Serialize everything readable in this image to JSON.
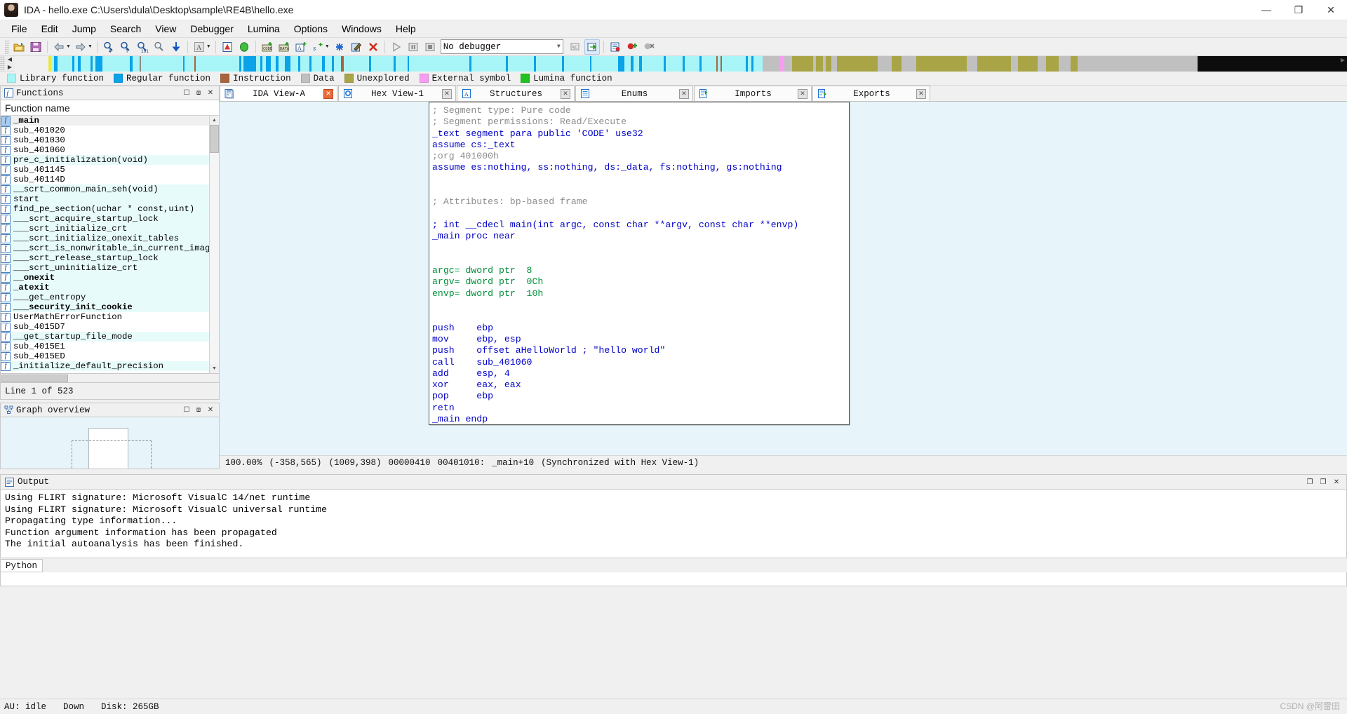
{
  "window": {
    "title": "IDA - hello.exe C:\\Users\\dula\\Desktop\\sample\\RE4B\\hello.exe",
    "minimize": "—",
    "maximize": "❐",
    "close": "✕"
  },
  "menu": {
    "items": [
      "File",
      "Edit",
      "Jump",
      "Search",
      "View",
      "Debugger",
      "Lumina",
      "Options",
      "Windows",
      "Help"
    ]
  },
  "toolbar": {
    "debugger_value": "No debugger",
    "caret": "∨"
  },
  "legend": {
    "items": [
      {
        "label": "Library function",
        "color": "#a8f5f8"
      },
      {
        "label": "Regular function",
        "color": "#0aa2e8"
      },
      {
        "label": "Instruction",
        "color": "#a9643c"
      },
      {
        "label": "Data",
        "color": "#c0c0c0"
      },
      {
        "label": "Unexplored",
        "color": "#a9a546"
      },
      {
        "label": "External symbol",
        "color": "#f79df2"
      },
      {
        "label": "Lumina function",
        "color": "#1fc21f"
      }
    ]
  },
  "functions_panel": {
    "title": "Functions",
    "column_header": "Function name",
    "status": "Line 1 of 523",
    "icon_glyph": "f",
    "rows": [
      {
        "name": "_main",
        "style": "sel bold"
      },
      {
        "name": "sub_401020",
        "style": ""
      },
      {
        "name": "sub_401030",
        "style": ""
      },
      {
        "name": "sub_401060",
        "style": ""
      },
      {
        "name": "pre_c_initialization(void)",
        "style": "lib"
      },
      {
        "name": "sub_401145",
        "style": ""
      },
      {
        "name": "sub_40114D",
        "style": ""
      },
      {
        "name": "__scrt_common_main_seh(void)",
        "style": "lib"
      },
      {
        "name": "start",
        "style": "lib"
      },
      {
        "name": "find_pe_section(uchar * const,uint)",
        "style": "lib"
      },
      {
        "name": "___scrt_acquire_startup_lock",
        "style": "lib"
      },
      {
        "name": "___scrt_initialize_crt",
        "style": "lib"
      },
      {
        "name": "___scrt_initialize_onexit_tables",
        "style": "lib"
      },
      {
        "name": "___scrt_is_nonwritable_in_current_image",
        "style": "lib"
      },
      {
        "name": "___scrt_release_startup_lock",
        "style": "lib"
      },
      {
        "name": "___scrt_uninitialize_crt",
        "style": "lib"
      },
      {
        "name": "__onexit",
        "style": "lib bold"
      },
      {
        "name": "_atexit",
        "style": "lib bold"
      },
      {
        "name": "___get_entropy",
        "style": "lib"
      },
      {
        "name": "___security_init_cookie",
        "style": "lib bold"
      },
      {
        "name": "UserMathErrorFunction",
        "style": ""
      },
      {
        "name": "sub_4015D7",
        "style": ""
      },
      {
        "name": "__get_startup_file_mode",
        "style": "lib"
      },
      {
        "name": "sub_4015E1",
        "style": ""
      },
      {
        "name": "sub_4015ED",
        "style": ""
      },
      {
        "name": "_initialize_default_precision",
        "style": "lib"
      }
    ]
  },
  "graph_panel": {
    "title": "Graph overview"
  },
  "tabs": [
    {
      "label": "IDA View-A",
      "icon": "document-icon",
      "active": true
    },
    {
      "label": "Hex View-1",
      "icon": "hex-icon",
      "active": false
    },
    {
      "label": "Structures",
      "icon": "struct-icon",
      "active": false
    },
    {
      "label": "Enums",
      "icon": "enums-icon",
      "active": false
    },
    {
      "label": "Imports",
      "icon": "imports-icon",
      "active": false
    },
    {
      "label": "Exports",
      "icon": "exports-icon",
      "active": false
    }
  ],
  "disassembly": {
    "lines": [
      {
        "text": "; Segment type: Pure code",
        "cls": "c-comment"
      },
      {
        "text": "; Segment permissions: Read/Execute",
        "cls": "c-comment"
      },
      {
        "text": "_text segment para public 'CODE' use32",
        "cls": "c-code"
      },
      {
        "text": "assume cs:_text",
        "cls": "c-code"
      },
      {
        "text": ";org 401000h",
        "cls": "c-comment"
      },
      {
        "text": "assume es:nothing, ss:nothing, ds:_data, fs:nothing, gs:nothing",
        "cls": "c-code"
      },
      {
        "text": "",
        "cls": "c-code"
      },
      {
        "text": "",
        "cls": "c-code"
      },
      {
        "text": "; Attributes: bp-based frame",
        "cls": "c-comment"
      },
      {
        "text": "",
        "cls": "c-code"
      },
      {
        "text": "; int __cdecl main(int argc, const char **argv, const char **envp)",
        "cls": "c-code"
      },
      {
        "text": "_main proc near",
        "cls": "c-code"
      },
      {
        "text": "",
        "cls": "c-code"
      },
      {
        "text": "",
        "cls": "c-code"
      },
      {
        "text": "argc= dword ptr  8",
        "cls": "c-green"
      },
      {
        "text": "argv= dword ptr  0Ch",
        "cls": "c-green"
      },
      {
        "text": "envp= dword ptr  10h",
        "cls": "c-green"
      },
      {
        "text": "",
        "cls": "c-code"
      },
      {
        "text": "",
        "cls": "c-code"
      },
      {
        "text": "push    ebp",
        "cls": "c-code"
      },
      {
        "text": "mov     ebp, esp",
        "cls": "c-code"
      },
      {
        "text": "push    offset aHelloWorld ; \"hello world\"",
        "cls": "c-code"
      },
      {
        "text": "call    sub_401060",
        "cls": "c-code"
      },
      {
        "text": "add     esp, 4",
        "cls": "c-code"
      },
      {
        "text": "xor     eax, eax",
        "cls": "c-code"
      },
      {
        "text": "pop     ebp",
        "cls": "c-code"
      },
      {
        "text": "retn",
        "cls": "c-code"
      },
      {
        "text": "_main endp",
        "cls": "c-code"
      }
    ]
  },
  "status_line": {
    "zoom": "100.00%",
    "offset": "(-358,565)",
    "coords": "(1009,398)",
    "file_offset": "00000410",
    "address": "00401010:",
    "symbol": "_main+10",
    "sync": "(Synchronized with Hex View-1)"
  },
  "output": {
    "title": "Output",
    "lines": [
      "Using FLIRT signature: Microsoft VisualC 14/net runtime",
      "Using FLIRT signature: Microsoft VisualC universal runtime",
      "Propagating type information...",
      "Function argument information has been propagated",
      "The initial autoanalysis has been finished."
    ],
    "tab_label": "Python",
    "restore": "❐",
    "float": "❐",
    "close": "✕"
  },
  "bottom_status": {
    "au": "AU: idle",
    "down": "Down",
    "disk": "Disk: 265GB"
  },
  "watermark": "CSDN @阿雷田",
  "colors": {
    "background": "#f0f0f0",
    "panel_bg": "#e7f5fb",
    "asm_blue": "#0000c8",
    "asm_comment": "#8c8c8c",
    "asm_green": "#008f39",
    "lib_row": "#e8fbfb",
    "nav_library": "#a8f5f8",
    "nav_regular": "#0aa2e8",
    "nav_unexplored": "#a9a546",
    "nav_data": "#c0c0c0"
  }
}
